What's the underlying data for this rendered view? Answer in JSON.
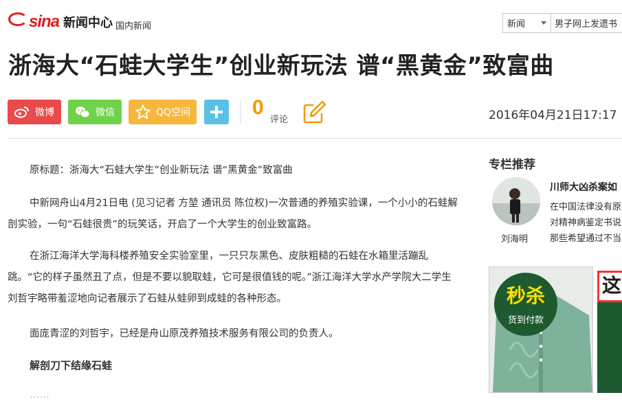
{
  "header": {
    "logo_text": "sina",
    "logo_sub": "新闻中心",
    "section": "国内新闻",
    "search": {
      "select_value": "新闻",
      "input_value": "男子网上发遗书"
    }
  },
  "article": {
    "title": "浙海大“石蛙大学生”创业新玩法 谱“黑黄金”致富曲",
    "share": {
      "weibo": "微博",
      "wechat": "微信",
      "qzone": "QQ空间"
    },
    "comment_count": "0",
    "comment_label": "评论",
    "publish_time": "2016年04月21日17:17",
    "paragraphs": [
      "原标题：浙海大“石蛙大学生”创业新玩法 谱“黑黄金”致富曲",
      "中新网舟山4月21日电 (见习记者 方堃 通讯员 陈位权)一次普通的养殖实验课，一个小小的石蛙解剖实验，一句“石蛙很贵”的玩笑话，开启了一个大学生的创业致富路。",
      "在浙江海洋大学海科楼养殖安全实验室里，一只只灰黑色、皮肤粗糙的石蛙在水箱里活蹦乱跳。“它的样子虽然丑了点，但是不要以貌取蛙，它可是很值钱的呢。”浙江海洋大学水产学院大二学生刘哲宇略带羞涩地向记者展示了石蛙从蛙卵到成蛙的各种形态。",
      "面庞青涩的刘哲宇，已经是舟山原茂养殖技术服务有限公司的负责人。",
      "解剖刀下结缘石蛙",
      "……"
    ]
  },
  "sidebar": {
    "column_title": "专栏推荐",
    "author": "刘海明",
    "column_headline": "川师大凶杀案如",
    "column_lines": [
      "在中国法律没有原",
      "对精神病鉴定书说",
      "那些希望通过不当"
    ],
    "ad": {
      "badge_big": "秒杀",
      "badge_small": "货到付款",
      "right_text": "这"
    }
  },
  "colors": {
    "brand_red": "#e41c1c",
    "weibo": "#e94a4a",
    "wechat": "#6fd24a",
    "qzone": "#f6b73c",
    "more": "#5ac1e3",
    "comment": "#f39800"
  },
  "icons": [
    "weibo-icon",
    "wechat-icon",
    "qzone-star-icon",
    "plus-icon",
    "edit-pencil-icon",
    "dropdown-caret-icon"
  ]
}
